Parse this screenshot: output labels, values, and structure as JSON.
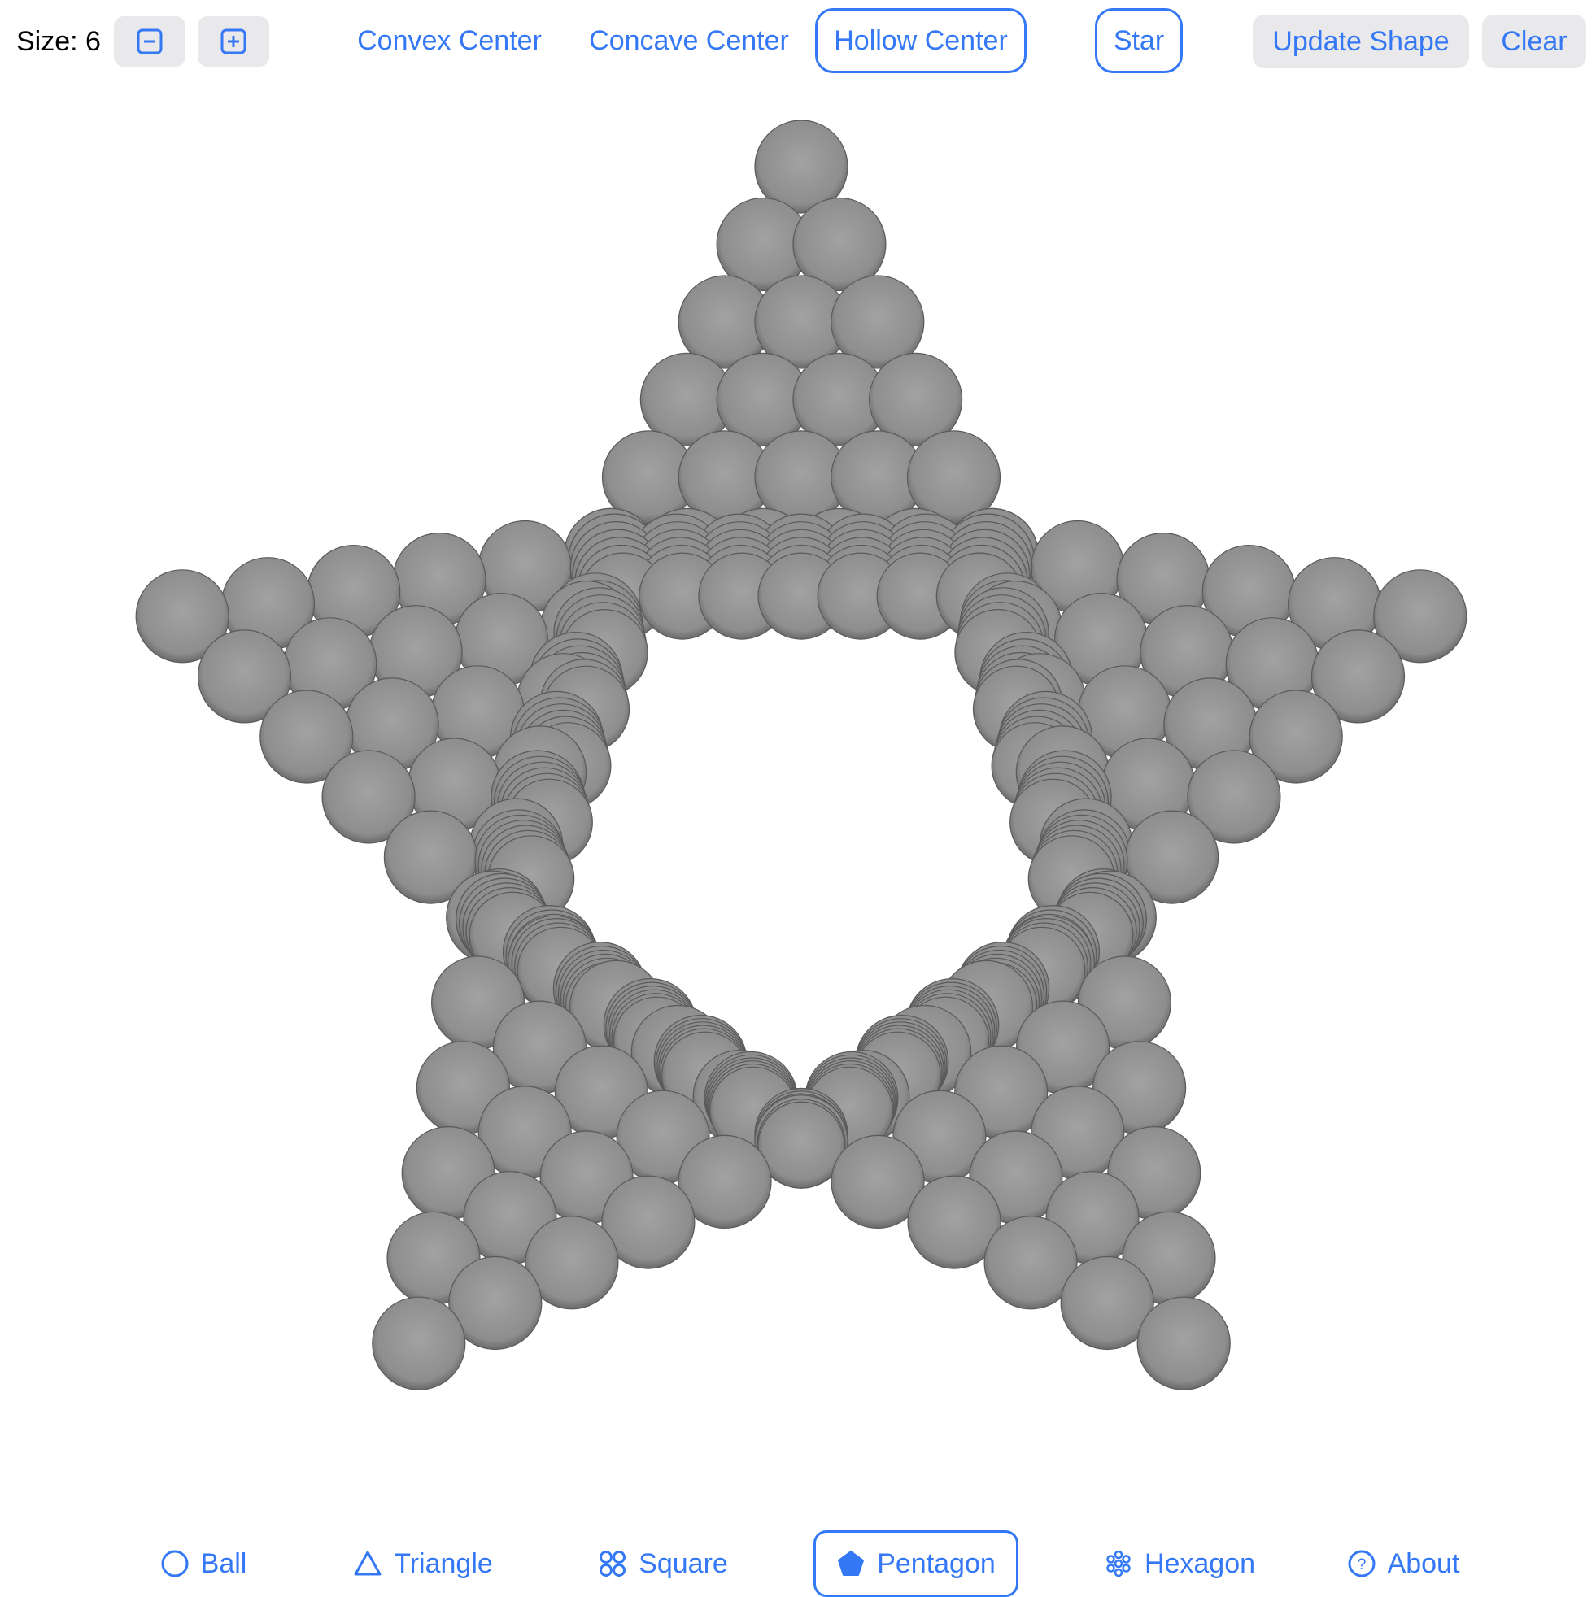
{
  "toolbar": {
    "size_label": "Size: 6",
    "decrease_icon": "minus-square-icon",
    "increase_icon": "plus-square-icon",
    "convex_label": "Convex Center",
    "concave_label": "Concave Center",
    "hollow_label": "Hollow Center",
    "star_label": "Star",
    "update_label": "Update Shape",
    "clear_label": "Clear"
  },
  "shape": {
    "type": "pentagon",
    "size": 6,
    "center_mode": "Hollow Center",
    "star": true,
    "ball_color": "#9a9a9a"
  },
  "tabs": {
    "ball": {
      "label": "Ball",
      "icon": "circle-icon"
    },
    "triangle": {
      "label": "Triangle",
      "icon": "triangle-icon"
    },
    "square": {
      "label": "Square",
      "icon": "four-circles-icon"
    },
    "pentagon": {
      "label": "Pentagon",
      "icon": "pentagon-filled-icon"
    },
    "hexagon": {
      "label": "Hexagon",
      "icon": "flower-icon"
    },
    "about": {
      "label": "About",
      "icon": "question-circle-icon"
    }
  },
  "colors": {
    "accent": "#3478f6",
    "button_fill": "#e9e9eb",
    "ball": "#9a9a9a"
  }
}
